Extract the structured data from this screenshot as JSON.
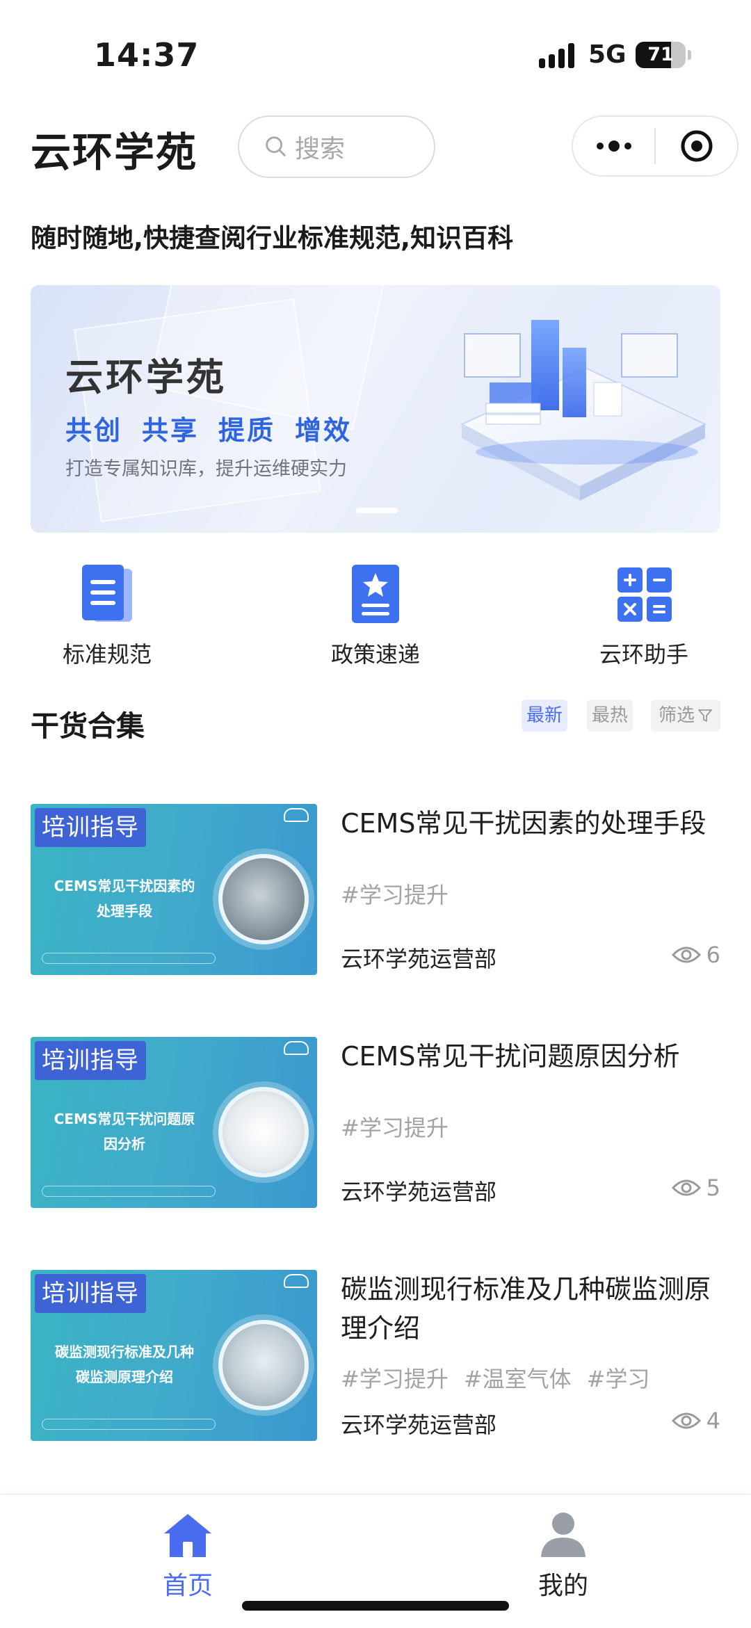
{
  "status_bar": {
    "time": "14:37",
    "network": "5G",
    "battery": "71",
    "battery_level": 0.71
  },
  "header": {
    "title": "云环学苑",
    "search_placeholder": "搜索"
  },
  "tagline": "随时随地,快捷查阅行业标准规范,知识百科",
  "banner": {
    "title": "云环学苑",
    "slogans": [
      "共创",
      "共享",
      "提质",
      "增效"
    ],
    "subtitle": "打造专属知识库，提升运维硬实力"
  },
  "quick_nav": [
    {
      "label": "标准规范",
      "icon": "document-list-icon"
    },
    {
      "label": "政策速递",
      "icon": "star-document-icon"
    },
    {
      "label": "云环助手",
      "icon": "calculator-icon"
    }
  ],
  "section": {
    "title": "干货合集",
    "filters": {
      "latest": "最新",
      "hot": "最热",
      "filter": "筛选"
    },
    "active_filter": "最新"
  },
  "articles": [
    {
      "thumb_tag": "培训指导",
      "thumb_text": "CEMS常见干扰因素的\n处理手段",
      "title": "CEMS常见干扰因素的处理手段",
      "tags": [
        "#学习提升"
      ],
      "author": "云环学苑运营部",
      "views": "6"
    },
    {
      "thumb_tag": "培训指导",
      "thumb_text": "CEMS常见干扰问题原\n因分析",
      "title": "CEMS常见干扰问题原因分析",
      "tags": [
        "#学习提升"
      ],
      "author": "云环学苑运营部",
      "views": "5"
    },
    {
      "thumb_tag": "培训指导",
      "thumb_text": "碳监测现行标准及几种\n碳监测原理介绍",
      "title": "碳监测现行标准及几种碳监测原理介绍",
      "tags": [
        "#学习提升",
        "#温室气体",
        "#学习"
      ],
      "author": "云环学苑运营部",
      "views": "4"
    }
  ],
  "tabbar": {
    "home": "首页",
    "mine": "我的",
    "active": "首页"
  },
  "colors": {
    "accent": "#4a6cf0",
    "slogan": "#2f64e0",
    "thumb_tag": "#3e63d4"
  }
}
